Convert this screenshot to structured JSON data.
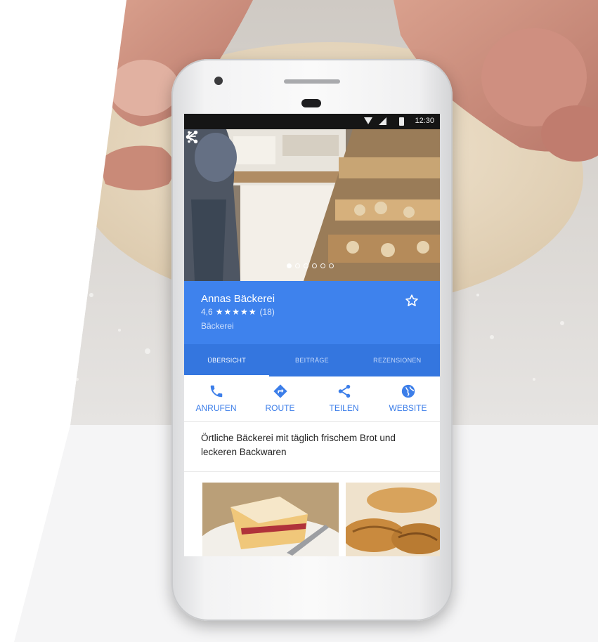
{
  "status_bar": {
    "time": "12:30"
  },
  "business": {
    "name": "Annas Bäckerei",
    "rating": "4,6",
    "stars": "★★★★★",
    "review_count": "(18)",
    "category": "Bäckerei",
    "description": "Örtliche Bäckerei mit täglich frischem Brot und leckeren Backwaren"
  },
  "tabs": [
    {
      "label": "ÜBERSICHT",
      "active": true
    },
    {
      "label": "BEITRÄGE",
      "active": false
    },
    {
      "label": "REZENSIONEN",
      "active": false
    }
  ],
  "actions": [
    {
      "label": "ANRUFEN",
      "icon": "phone-icon"
    },
    {
      "label": "ROUTE",
      "icon": "directions-icon"
    },
    {
      "label": "TEILEN",
      "icon": "share-icon"
    },
    {
      "label": "WEBSITE",
      "icon": "globe-icon"
    }
  ],
  "colors": {
    "accent": "#3e82ed",
    "tab_bar": "#3476df",
    "action_blue": "#3c7ee9"
  },
  "gallery": {
    "dots": 6,
    "active_dot": 0
  }
}
